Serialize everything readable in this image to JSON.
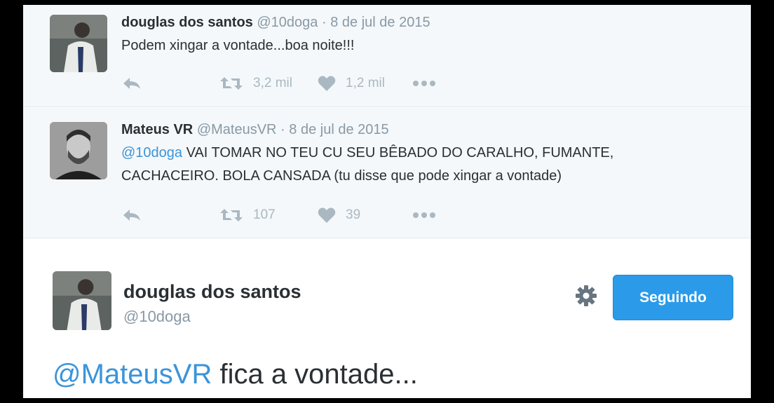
{
  "tweets": [
    {
      "name": "douglas dos santos",
      "handle": "@10doga",
      "separator": "·",
      "date": "8 de jul de 2015",
      "text": "Podem xingar a vontade...boa noite!!!",
      "retweets": "3,2 mil",
      "likes": "1,2 mil"
    },
    {
      "name": "Mateus VR",
      "handle": "@MateusVR",
      "separator": "·",
      "date": "8 de jul de 2015",
      "mention": "@10doga",
      "text_line1_rest": " VAI TOMAR NO TEU CU SEU BÊBADO DO CARALHO, FUMANTE,",
      "text_line2": "CACHACEIRO. BOLA CANSADA (tu disse que pode xingar a vontade)",
      "retweets": "107",
      "likes": "39"
    }
  ],
  "main_tweet": {
    "name": "douglas dos santos",
    "handle": "@10doga",
    "follow_label": "Seguindo",
    "mention": "@MateusVR",
    "text_rest": " fica a vontade..."
  },
  "icons": {
    "reply": "reply-icon",
    "retweet": "retweet-icon",
    "like": "heart-icon",
    "more": "more-icon",
    "settings": "gear-icon"
  },
  "colors": {
    "mention": "#3b94d9",
    "follow_button": "#2b9be9",
    "action_icon": "#aab8c2",
    "meta_text": "#8899a6"
  }
}
